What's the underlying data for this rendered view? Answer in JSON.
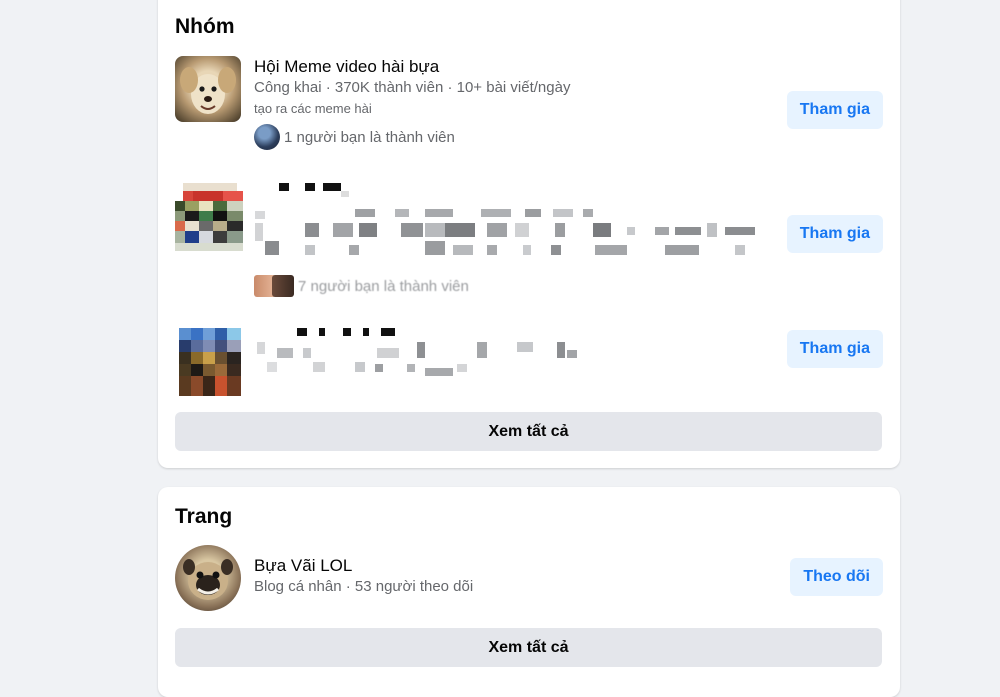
{
  "groups_section": {
    "title": "Nhóm",
    "items": [
      {
        "name": "Hội Meme video hài bựa",
        "meta": "Công khai · 370K thành viên · 10+ bài viết/ngày",
        "description": "tạo ra các meme hài",
        "friends": "1 người bạn là thành viên",
        "button": "Tham gia"
      },
      {
        "name": "",
        "friends": "7 người bạn là thành viên",
        "button": "Tham gia"
      },
      {
        "name": "",
        "button": "Tham gia"
      }
    ],
    "see_all": "Xem tất cả"
  },
  "pages_section": {
    "title": "Trang",
    "items": [
      {
        "name": "Bựa Vãi LOL",
        "meta": "Blog cá nhân · 53 người theo dõi",
        "button": "Theo dõi"
      }
    ],
    "see_all": "Xem tất cả"
  },
  "colors": {
    "accent": "#1877f2",
    "accent_bg": "#e7f3ff",
    "secondary_text": "#65676b",
    "button_grey": "#e4e6eb",
    "page_bg": "#f0f2f5"
  },
  "icons": {
    "group1_thumb": "dog-photo",
    "group2_thumb": "pixelated-photo",
    "group3_thumb": "pixelated-photo",
    "friend_avatar": "friend-avatar",
    "page_avatar": "pug-photo"
  }
}
